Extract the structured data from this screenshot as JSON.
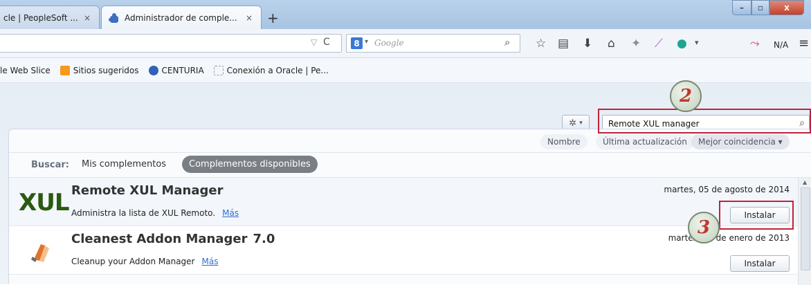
{
  "tabs": [
    {
      "label": "cle | PeopleSoft ...",
      "close": "×"
    },
    {
      "label": "Administrador de comple...",
      "close": "×"
    }
  ],
  "new_tab": "+",
  "window_controls": {
    "minimize": "–",
    "maximize": "▫",
    "close": "x"
  },
  "navbar": {
    "url_dropdown": "▽",
    "reload": "C",
    "search_engine_letter": "8",
    "search_dropdown": "▾",
    "search_placeholder": "Google",
    "search_icon": "⌕",
    "toolbar_text_na": "N/A",
    "menu_icon": "≡"
  },
  "bookmarks": [
    {
      "label": "le Web Slice",
      "icon": "web-slice-icon"
    },
    {
      "label": "Sitios sugeridos",
      "icon": "suggested-sites-icon",
      "color": "#f59a1c"
    },
    {
      "label": "CENTURIA",
      "icon": "centuria-icon",
      "color": "#2f62b8"
    },
    {
      "label": "Conexión a Oracle | Pe...",
      "icon": "page-icon"
    }
  ],
  "addon_manager": {
    "search_value": "Remote XUL manager",
    "sort_buttons": {
      "name": "Nombre",
      "updated": "Última actualización",
      "best": "Mejor coincidencia ▾"
    },
    "buscar_label": "Buscar:",
    "scope_mine": "Mis complementos",
    "scope_available": "Complementos disponibles",
    "results": [
      {
        "name": "Remote XUL Manager",
        "version": "",
        "description": "Administra la lista de XUL Remoto.",
        "more": "Más",
        "date": "martes, 05 de agosto de 2014",
        "install": "Instalar",
        "logo_text": "XUL"
      },
      {
        "name": "Cleanest Addon Manager",
        "version": "7.0",
        "description": "Cleanup your Addon Manager",
        "more": "Más",
        "date": "martes, 22 de enero de 2013",
        "install": "Instalar"
      }
    ]
  },
  "annotations": {
    "step2": "2",
    "step3": "3",
    "highlight_color": "#c0233b"
  }
}
